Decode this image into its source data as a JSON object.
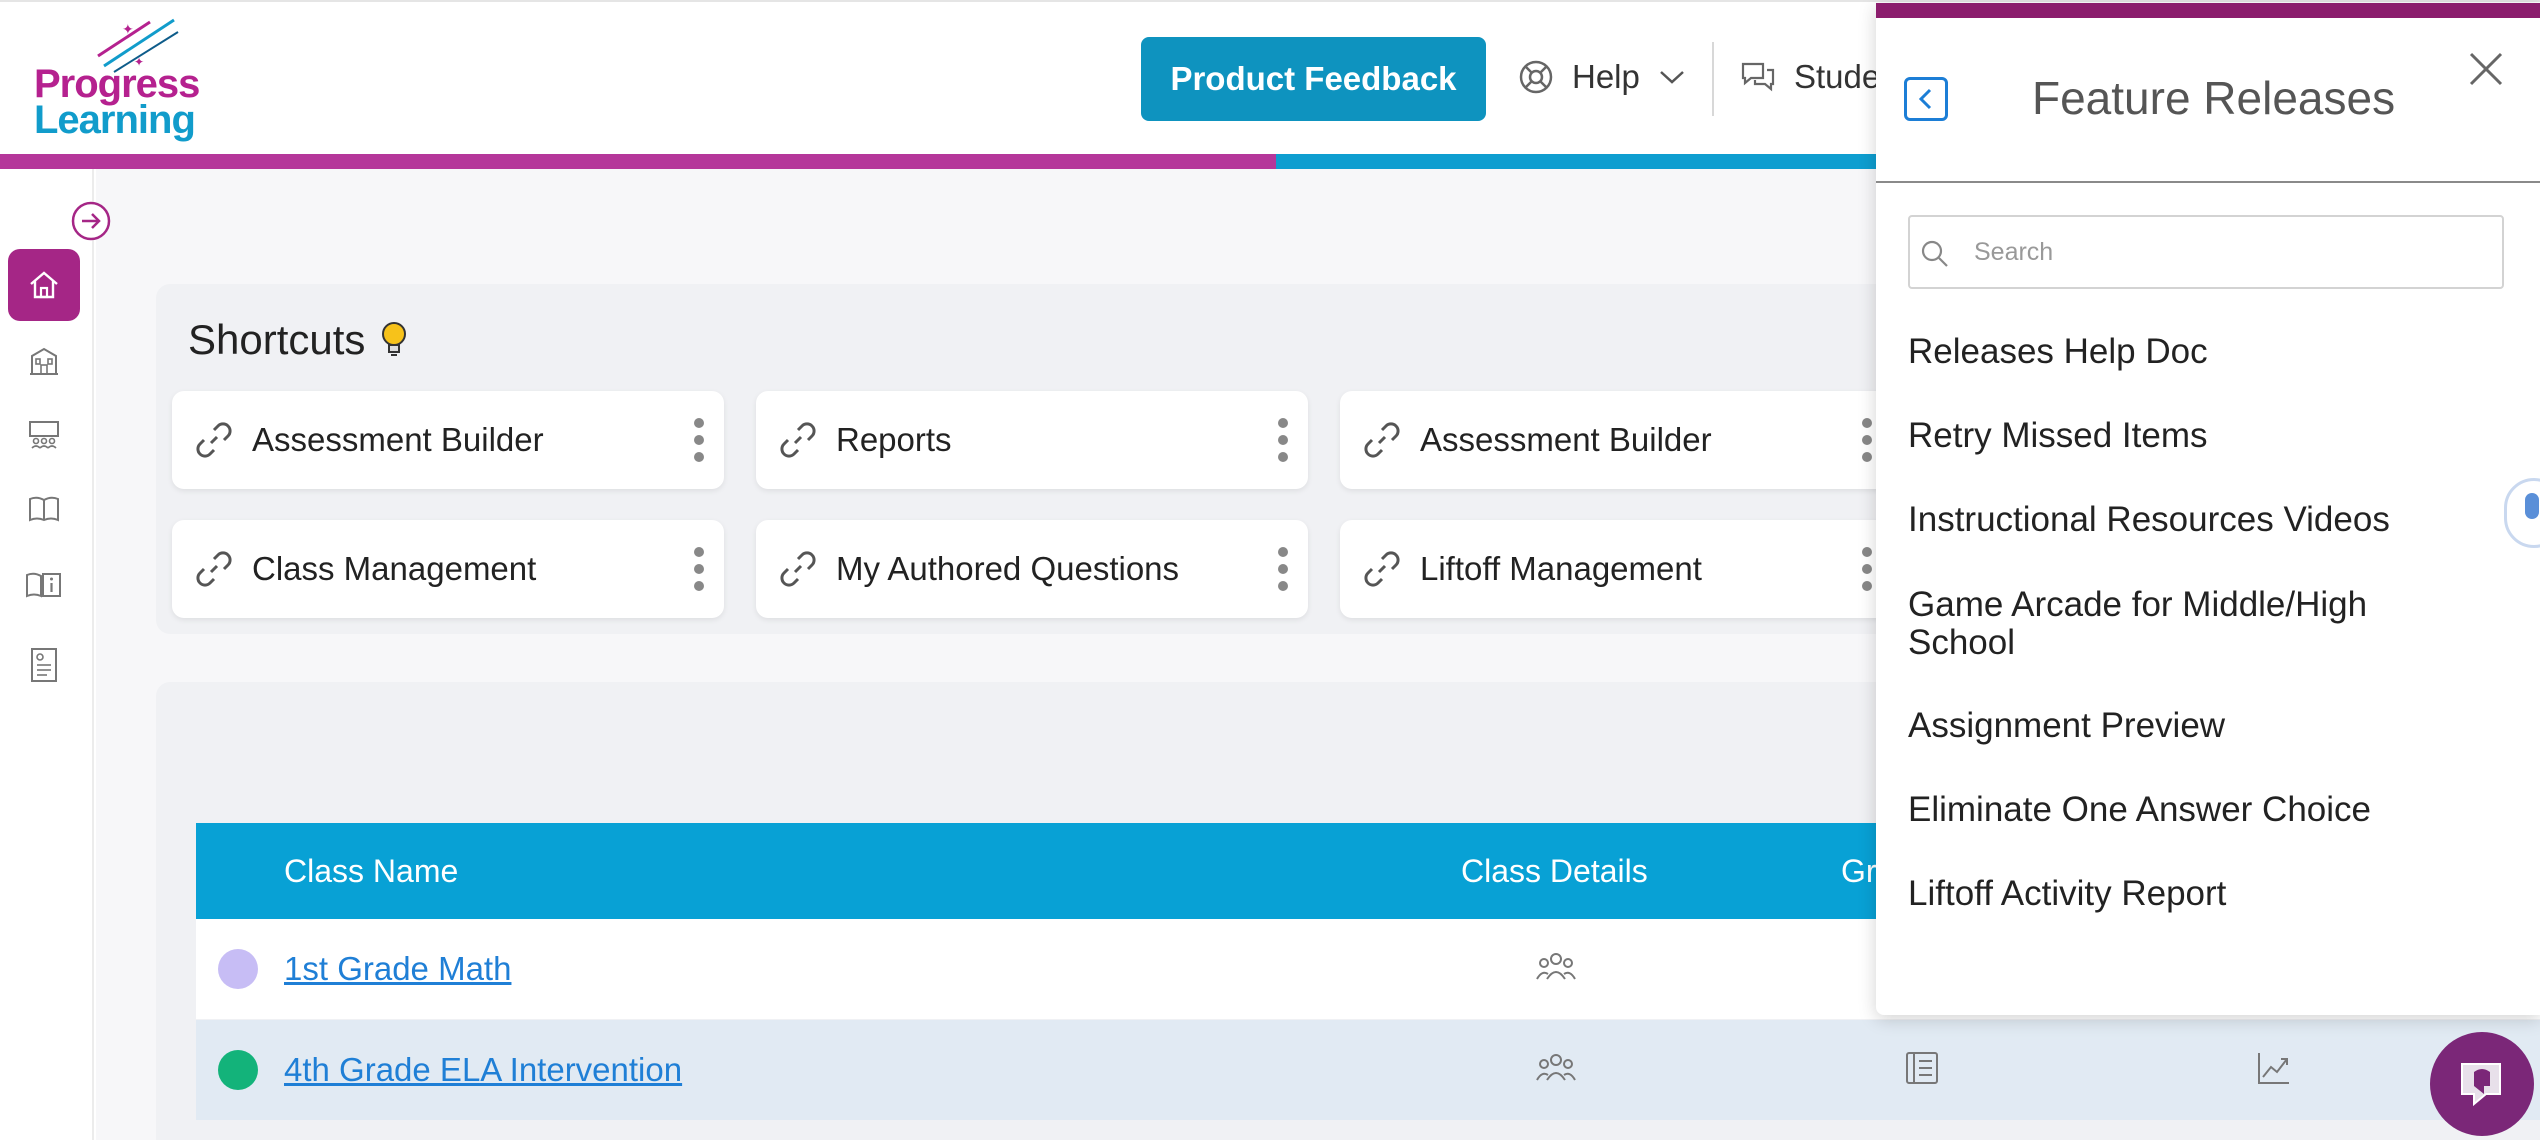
{
  "header": {
    "logo_line1": "Progress",
    "logo_line2": "Learning",
    "feedback_label": "Product Feedback",
    "help_label": "Help",
    "students_label": "Stude"
  },
  "sidebar": {
    "items": [
      {
        "icon": "home-icon"
      },
      {
        "icon": "school-building-icon"
      },
      {
        "icon": "classroom-icon"
      },
      {
        "icon": "book-icon"
      },
      {
        "icon": "book-info-icon"
      },
      {
        "icon": "report-document-icon"
      }
    ]
  },
  "shortcuts": {
    "title": "Shortcuts",
    "cards": [
      {
        "label": "Assessment Builder"
      },
      {
        "label": "Reports"
      },
      {
        "label": "Assessment Builder"
      },
      {
        "label": "Class Management"
      },
      {
        "label": "My Authored Questions"
      },
      {
        "label": "Liftoff Management"
      }
    ]
  },
  "table": {
    "headers": {
      "class_name": "Class Name",
      "class_details": "Class Details",
      "gr": "Gr"
    },
    "rows": [
      {
        "name": "1st Grade Math",
        "color": "#c7bdf5"
      },
      {
        "name": "4th Grade ELA Intervention",
        "color": "#13b37a"
      }
    ]
  },
  "feature_releases": {
    "title": "Feature Releases",
    "search_placeholder": "Search",
    "items": [
      "Releases Help Doc",
      "Retry Missed Items",
      "Instructional Resources Videos",
      "Game Arcade for Middle/High School",
      "Assignment Preview",
      "Eliminate One Answer Choice",
      "Liftoff Activity Report"
    ]
  },
  "colors": {
    "brand_pink": "#b5218f",
    "brand_blue": "#119ccb",
    "button_blue": "#0e93bf",
    "table_header": "#08a1d5",
    "panel_accent": "#8b1d6d",
    "chat_purple": "#7b2778"
  }
}
